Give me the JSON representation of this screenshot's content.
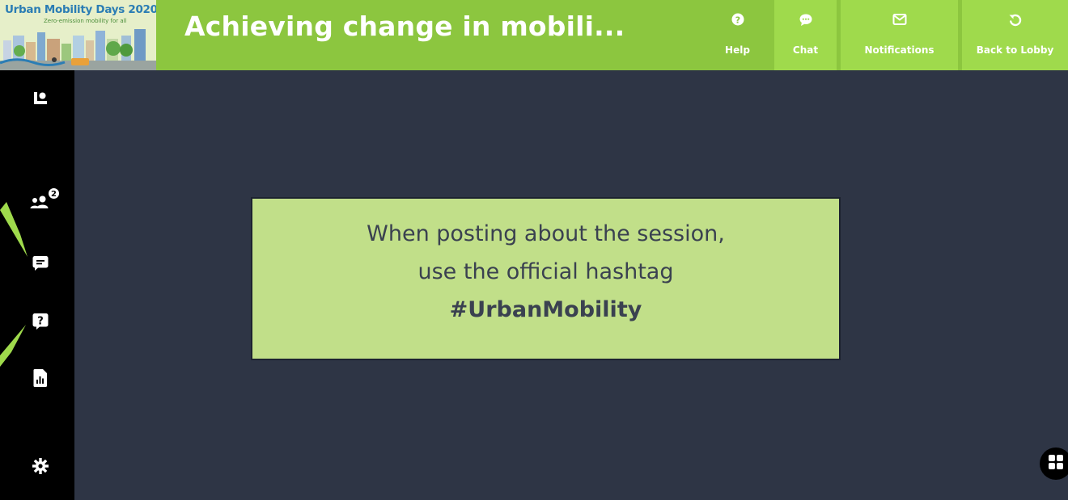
{
  "header": {
    "logo": {
      "title": "Urban Mobility Days 2020",
      "subtitle": "Zero-emission mobility for all"
    },
    "session_title": "Achieving change in mobili...",
    "nav": [
      {
        "label": "Help",
        "icon": "question-circle-icon"
      },
      {
        "label": "Chat",
        "icon": "chat-bubble-icon"
      },
      {
        "label": "Notifications",
        "icon": "envelope-icon"
      },
      {
        "label": "Back to Lobby",
        "icon": "undo-icon"
      }
    ]
  },
  "sidebar": {
    "items": [
      {
        "icon": "presenter-icon"
      },
      {
        "icon": "participants-icon",
        "badge": "2"
      },
      {
        "icon": "chat-message-icon"
      },
      {
        "icon": "question-icon"
      },
      {
        "icon": "poll-report-icon"
      },
      {
        "icon": "settings-gear-icon"
      }
    ]
  },
  "notice": {
    "line1": "When posting about the session,",
    "line2": "use the official hashtag",
    "hashtag": "#UrbanMobility"
  },
  "colors": {
    "topbar": "#8cc63f",
    "nav_button": "#9fda4c",
    "stage_background": "#2e3545",
    "sidebar": "#000000",
    "notice_background": "#c1df89"
  },
  "icons": {
    "layout_toggle": "grid-layout-icon"
  }
}
